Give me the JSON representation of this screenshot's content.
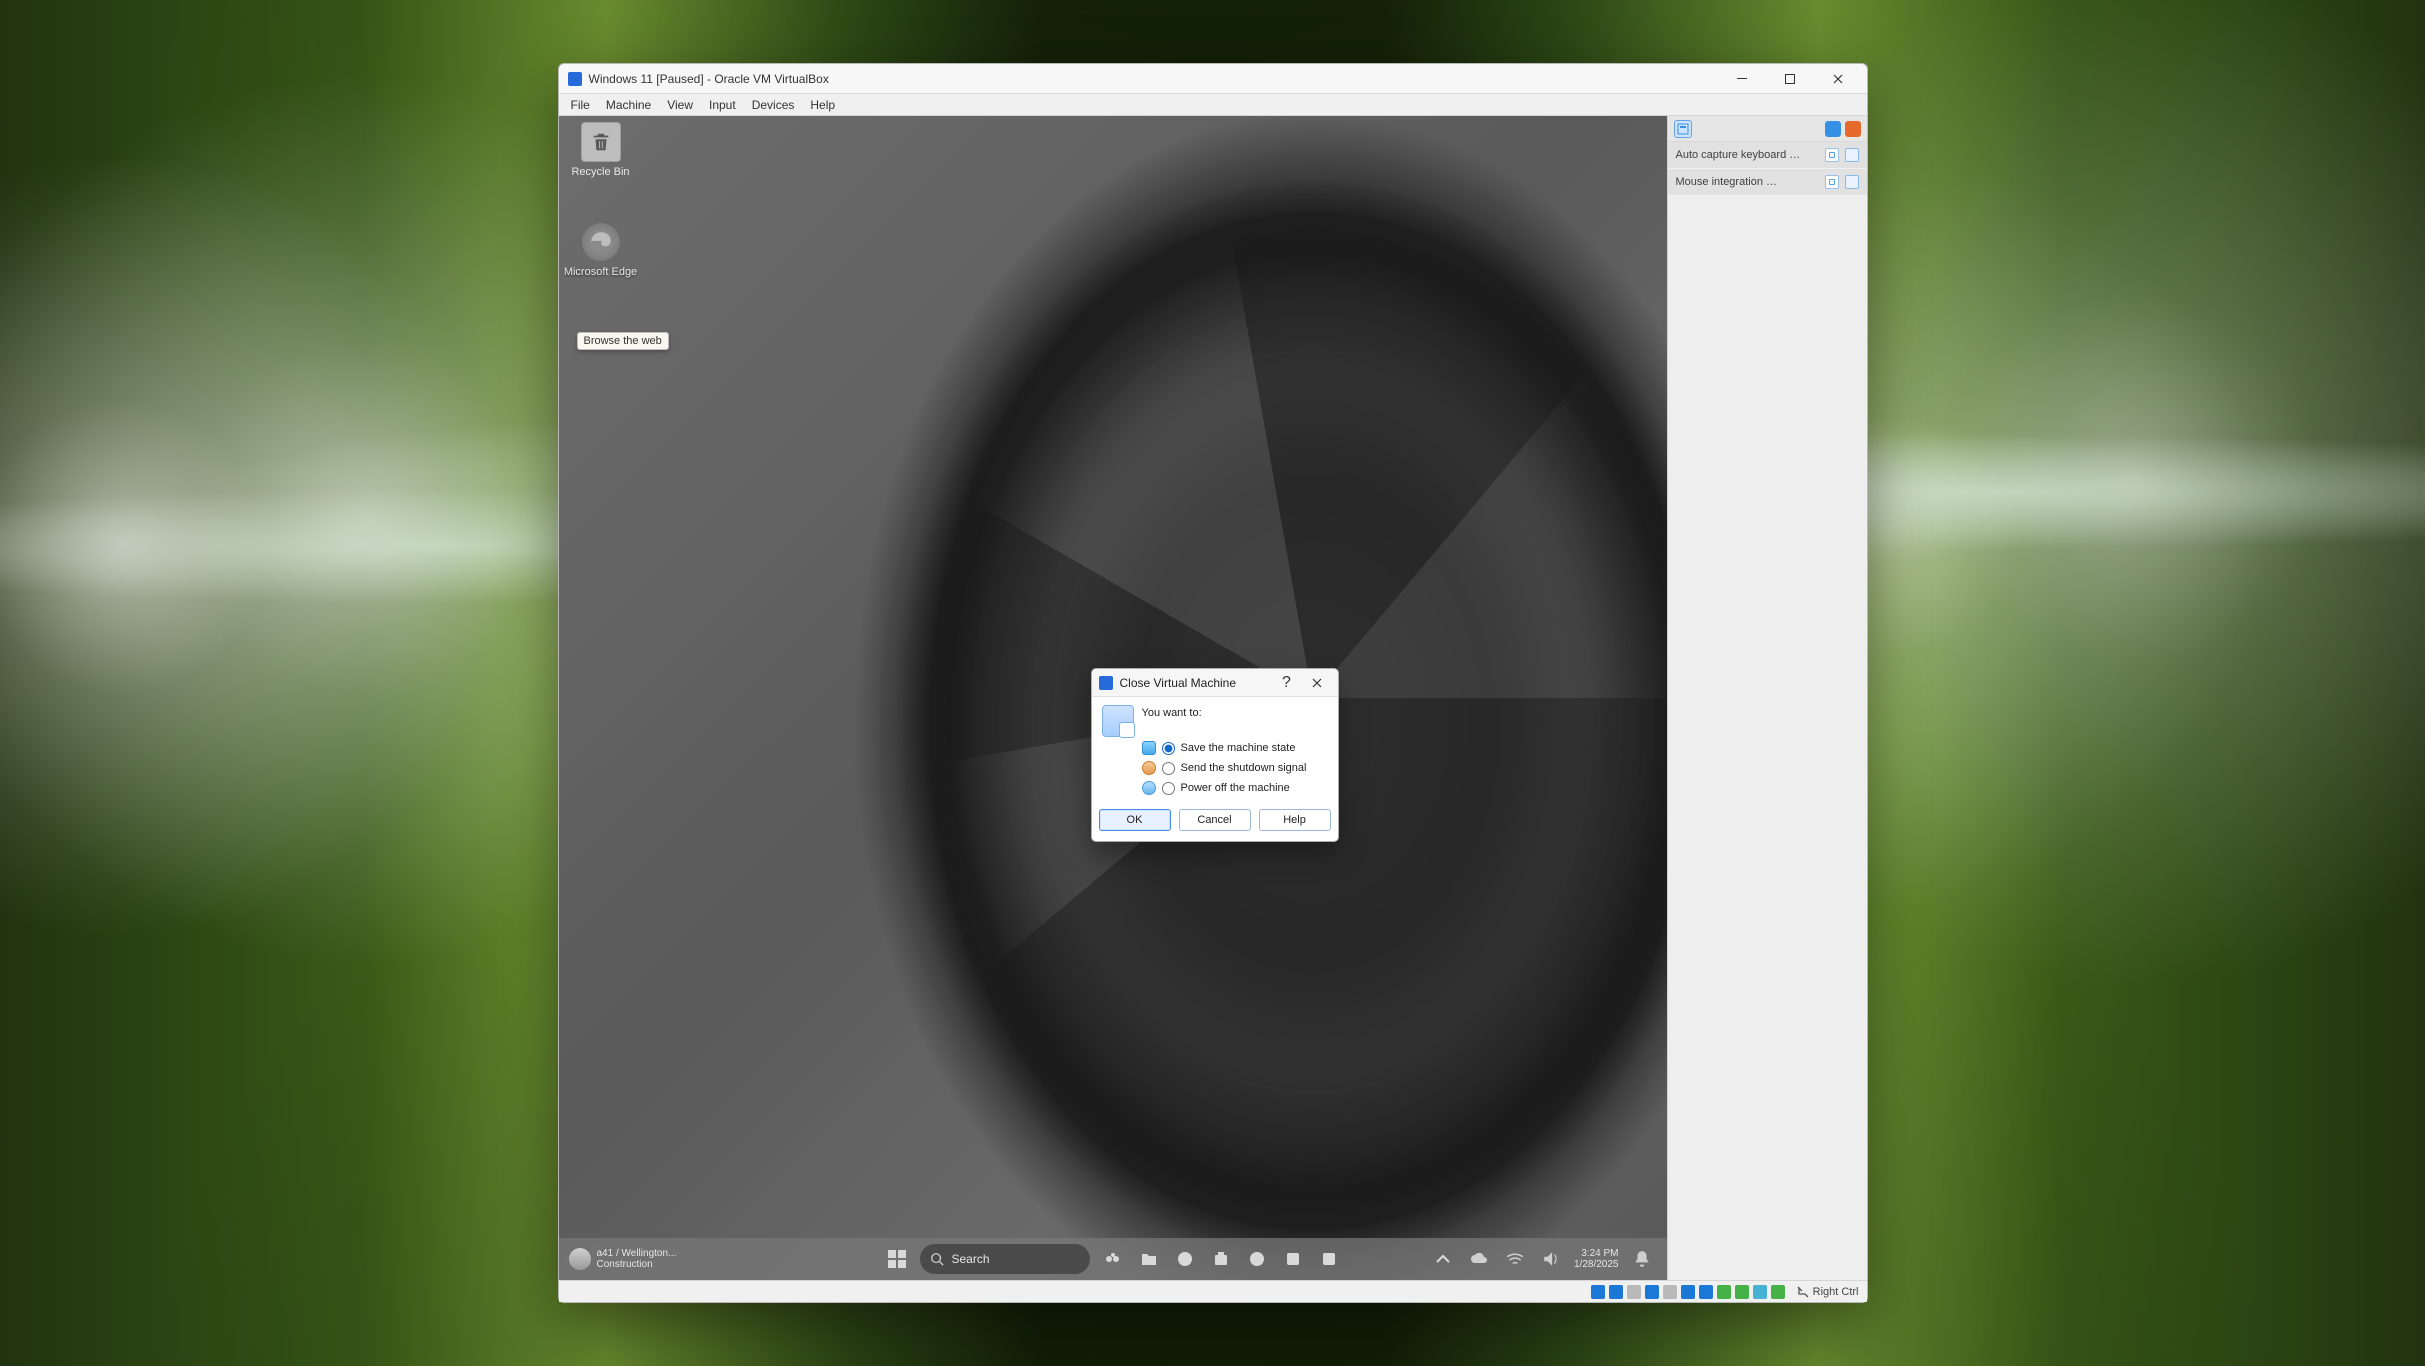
{
  "window": {
    "title": "Windows 11 [Paused] - Oracle VM VirtualBox",
    "menu": [
      "File",
      "Machine",
      "View",
      "Input",
      "Devices",
      "Help"
    ]
  },
  "guest": {
    "icons": {
      "recycle": "Recycle Bin",
      "edge": "Microsoft Edge"
    },
    "tooltip": "Browse the web",
    "taskbar": {
      "search_placeholder": "Search",
      "weather_line1": "a41 / Wellington...",
      "weather_line2": "Construction",
      "clock_time": "3:24 PM",
      "clock_date": "1/28/2025"
    }
  },
  "right_panel": {
    "items": [
      "Auto capture keyboard …",
      "Mouse integration …"
    ]
  },
  "statusbar": {
    "host_key": "Right Ctrl"
  },
  "dialog": {
    "title": "Close Virtual Machine",
    "prompt": "You want to:",
    "options": {
      "save": "Save the machine state",
      "shutdown": "Send the shutdown signal",
      "poweroff": "Power off the machine"
    },
    "buttons": {
      "ok": "OK",
      "cancel": "Cancel",
      "help": "Help"
    }
  }
}
